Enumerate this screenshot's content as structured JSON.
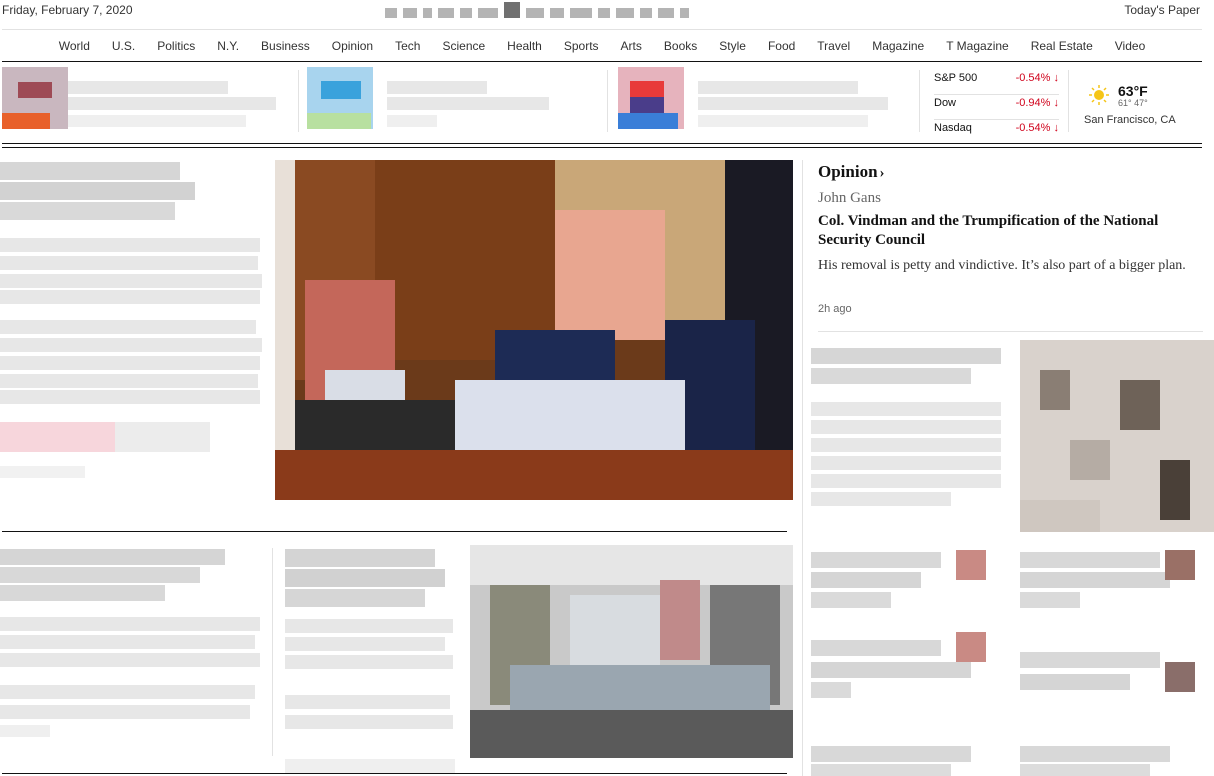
{
  "header": {
    "date": "Friday, February 7, 2020",
    "todays_paper": "Today's Paper"
  },
  "nav": [
    {
      "label": "World"
    },
    {
      "label": "U.S."
    },
    {
      "label": "Politics"
    },
    {
      "label": "N.Y."
    },
    {
      "label": "Business"
    },
    {
      "label": "Opinion"
    },
    {
      "label": "Tech"
    },
    {
      "label": "Science"
    },
    {
      "label": "Health"
    },
    {
      "label": "Sports"
    },
    {
      "label": "Arts"
    },
    {
      "label": "Books"
    },
    {
      "label": "Style"
    },
    {
      "label": "Food"
    },
    {
      "label": "Travel"
    },
    {
      "label": "Magazine"
    },
    {
      "label": "T Magazine"
    },
    {
      "label": "Real Estate"
    },
    {
      "label": "Video"
    }
  ],
  "markets": [
    {
      "name": "S&P 500",
      "change": "-0.54%",
      "arrow": "↓"
    },
    {
      "name": "Dow",
      "change": "-0.94%",
      "arrow": "↓"
    },
    {
      "name": "Nasdaq",
      "change": "-0.54%",
      "arrow": "↓"
    }
  ],
  "weather": {
    "temp": "63°F",
    "hilo": "61° 47°",
    "city": "San Francisco, CA",
    "icon": "sun-icon"
  },
  "opinion": {
    "section_label": "Opinion",
    "author": "John Gans",
    "headline": "Col. Vindman and the Trumpification of the National Security Council",
    "summary": "His removal is petty and vindictive. It’s also part of a bigger plan.",
    "time": "2h ago"
  },
  "colors": {
    "market_down": "#d0021b",
    "rule_dark": "#121212",
    "rule_light": "#e2e2e2"
  }
}
